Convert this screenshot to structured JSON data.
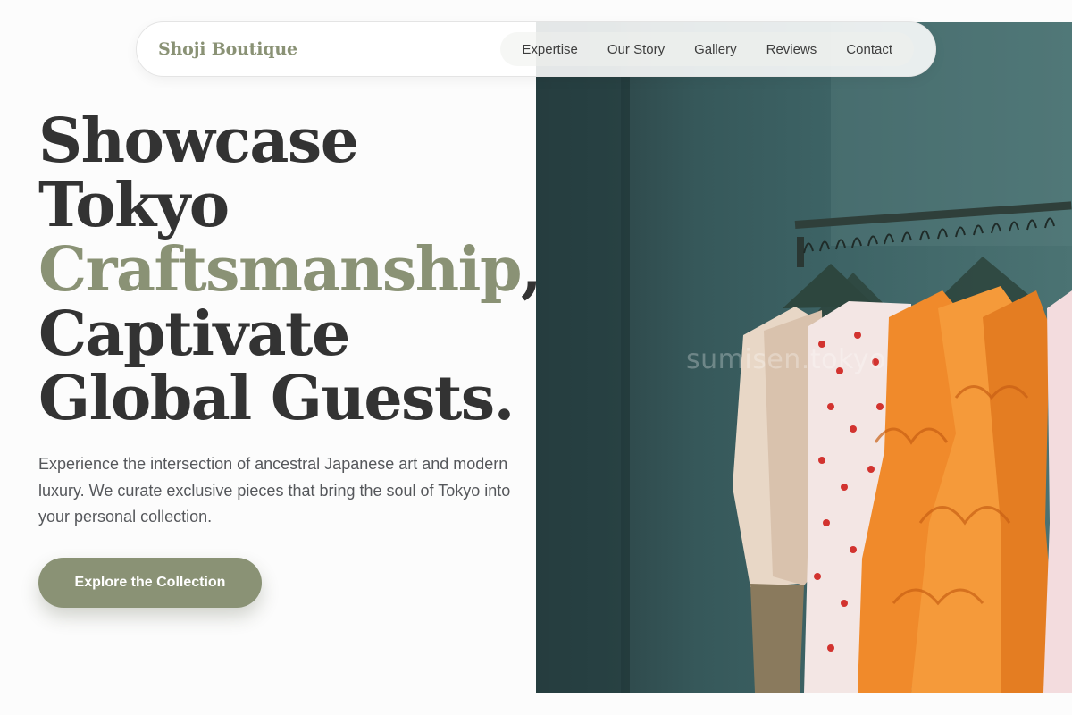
{
  "nav": {
    "brand": "Shoji Boutique",
    "links": [
      "Expertise",
      "Our Story",
      "Gallery",
      "Reviews",
      "Contact"
    ]
  },
  "hero": {
    "line1": "Showcase",
    "line2": "Tokyo",
    "accent_word": "Craftsmanship",
    "accent_punct": ",",
    "line4": "Captivate",
    "line5": "Global Guests.",
    "description": "Experience the intersection of ancestral Japanese art and modern luxury. We curate exclusive pieces that bring the soul of Tokyo into your personal collection.",
    "cta_label": "Explore the Collection",
    "image_watermark": "sumisen.tokyo"
  },
  "colors": {
    "accent": "#8a9275",
    "text": "#333333",
    "background": "#fcfcfc"
  }
}
